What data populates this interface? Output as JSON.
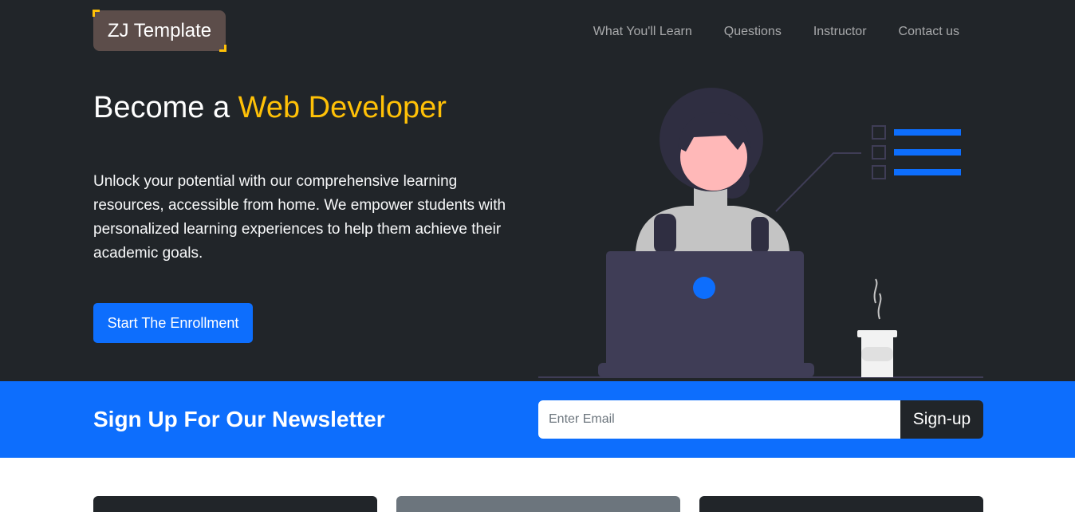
{
  "brand": {
    "name": "ZJ Template"
  },
  "nav": {
    "items": [
      {
        "label": "What You'll Learn"
      },
      {
        "label": "Questions"
      },
      {
        "label": "Instructor"
      },
      {
        "label": "Contact us"
      }
    ]
  },
  "hero": {
    "title_plain": "Become a",
    "title_accent": "Web Developer",
    "description": "Unlock your potential with our comprehensive learning resources, accessible from home. We empower students with personalized learning experiences to help them achieve their academic goals.",
    "cta_label": "Start The Enrollment"
  },
  "newsletter": {
    "title": "Sign Up For Our Newsletter",
    "email_placeholder": "Enter Email",
    "email_value": "",
    "button_label": "Sign-up"
  },
  "colors": {
    "dark": "#212529",
    "accent": "#ffc107",
    "primary": "#0d6efd",
    "brand_bg": "#5c4d4a",
    "secondary": "#6c757d"
  },
  "icons": [
    "person-with-laptop-illustration",
    "checklist-icon",
    "coffee-cup-icon"
  ]
}
